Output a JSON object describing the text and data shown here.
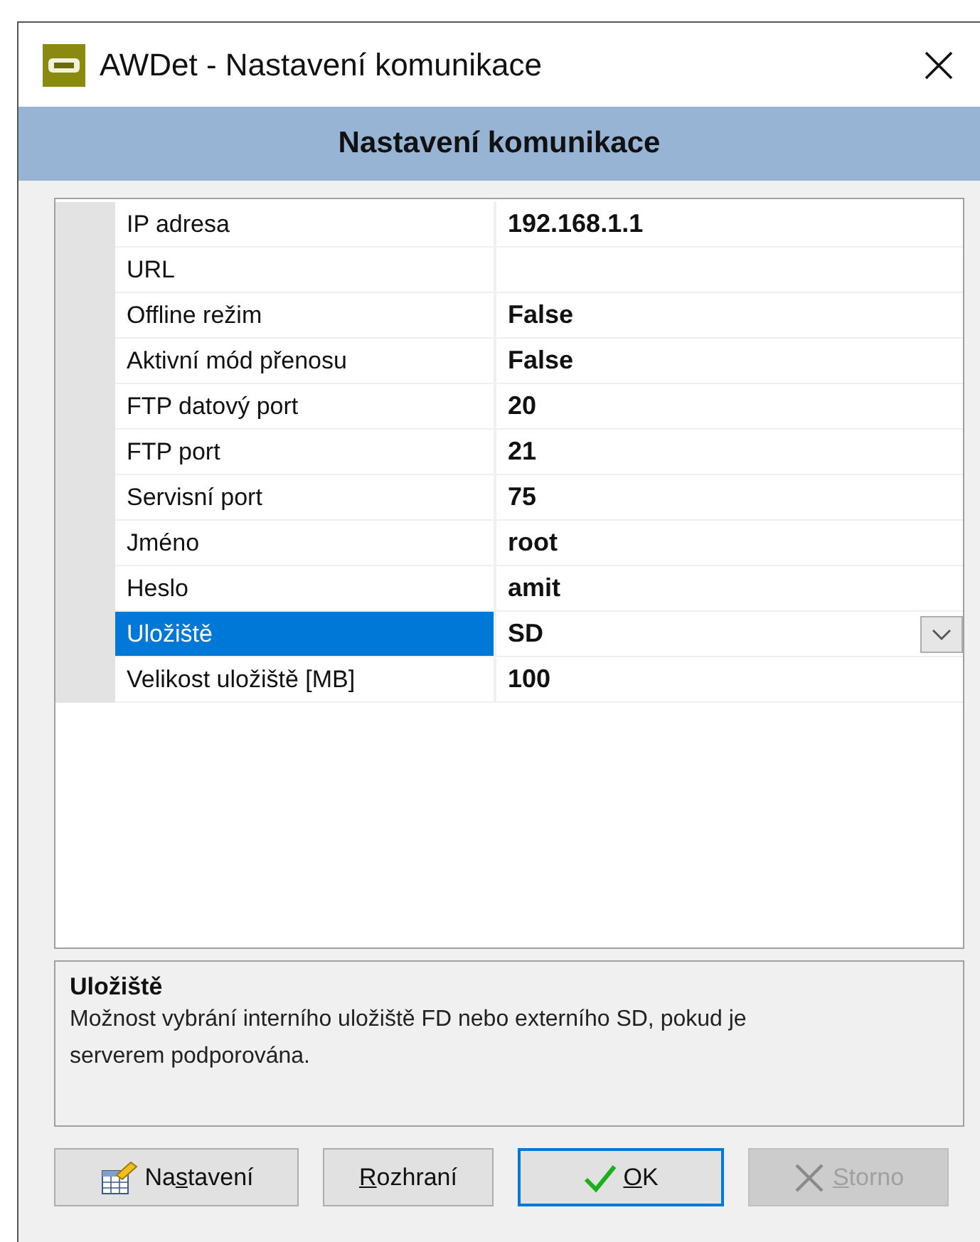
{
  "window": {
    "title": "AWDet - Nastavení komunikace"
  },
  "header": "Nastavení komunikace",
  "properties": [
    {
      "name": "IP adresa",
      "value": "192.168.1.1",
      "kind": "text",
      "selected": false
    },
    {
      "name": "URL",
      "kind": "text",
      "selected": false
    },
    {
      "name": "Offline režim",
      "value": "False",
      "kind": "text",
      "selected": false
    },
    {
      "name": "Aktivní mód přenosu",
      "value": "False",
      "kind": "text",
      "selected": false
    },
    {
      "name": "FTP datový port",
      "value": "20",
      "kind": "text",
      "selected": false
    },
    {
      "name": "FTP port",
      "value": "21",
      "kind": "text",
      "selected": false
    },
    {
      "name": "Servisní port",
      "value": "75",
      "kind": "text",
      "selected": false
    },
    {
      "name": "Jméno",
      "value": "root",
      "kind": "text",
      "selected": false
    },
    {
      "name": "Heslo",
      "value": "amit",
      "kind": "text",
      "selected": false
    },
    {
      "name": "Uložiště",
      "value": "SD",
      "kind": "dropdown",
      "selected": true
    },
    {
      "name": "Velikost uložiště [MB]",
      "value": "100",
      "kind": "text",
      "selected": false
    }
  ],
  "description": {
    "title": "Uložiště",
    "text": "Možnost vybrání interního uložiště FD nebo externího SD, pokud je serverem podporována."
  },
  "buttons": [
    {
      "label_before": "Na",
      "mnemonic": "s",
      "label_after": "tavení",
      "kind": "settings",
      "default": false,
      "disabled": false
    },
    {
      "mnemonic": "R",
      "label_after": "ozhraní",
      "kind": "plain",
      "default": false,
      "disabled": false
    },
    {
      "mnemonic": "O",
      "label_after": "K",
      "kind": "ok",
      "default": true,
      "disabled": false
    },
    {
      "mnemonic": "S",
      "label_after": "torno",
      "kind": "cancel",
      "default": false,
      "disabled": true
    }
  ]
}
